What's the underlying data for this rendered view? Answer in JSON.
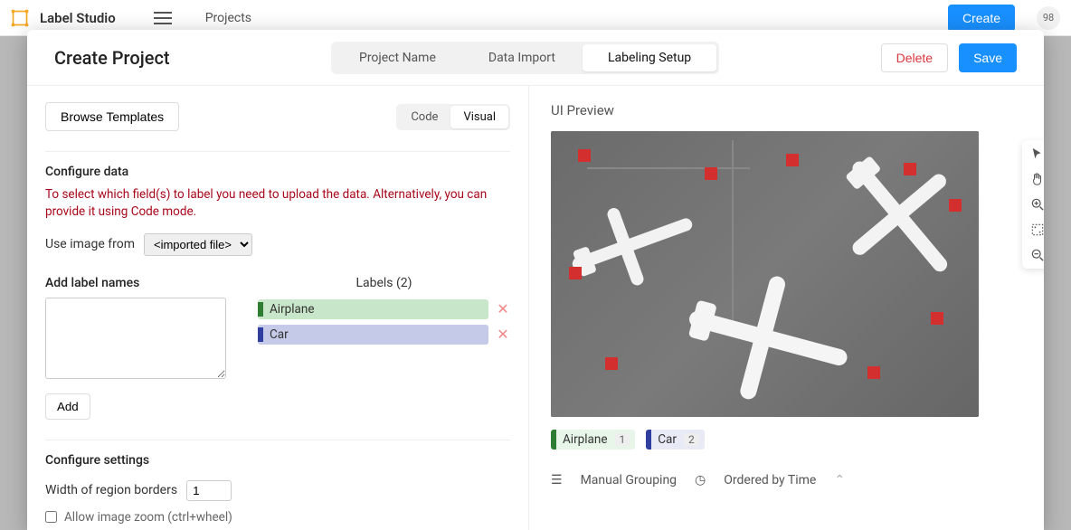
{
  "app": {
    "name": "Label Studio",
    "breadcrumb": "Projects",
    "create_btn": "Create",
    "badge": "98"
  },
  "modal": {
    "title": "Create Project",
    "tabs": {
      "t1": "Project Name",
      "t2": "Data Import",
      "t3": "Labeling Setup"
    },
    "actions": {
      "delete": "Delete",
      "save": "Save"
    }
  },
  "left": {
    "browse_templates": "Browse Templates",
    "mini_tabs": {
      "code": "Code",
      "visual": "Visual"
    },
    "configure_data": "Configure data",
    "warn": "To select which field(s) to label you need to upload the data. Alternatively, you can provide it using Code mode.",
    "use_image_from": "Use image from",
    "imported_file": "<imported file>",
    "add_label_names": "Add label names",
    "labels_heading": "Labels (2)",
    "labels": [
      {
        "name": "Airplane",
        "color_class": "chip-airplane"
      },
      {
        "name": "Car",
        "color_class": "chip-car"
      }
    ],
    "add_btn": "Add",
    "configure_settings": "Configure settings",
    "width_region": "Width of region borders",
    "width_value": "1",
    "allow_zoom": "Allow image zoom (ctrl+wheel)"
  },
  "right": {
    "ui_preview": "UI Preview",
    "chips": [
      {
        "name": "Airplane",
        "key": "1",
        "cls": "bc-air"
      },
      {
        "name": "Car",
        "key": "2",
        "cls": "bc-car"
      }
    ],
    "grouping": "Manual Grouping",
    "ordered": "Ordered by Time"
  }
}
